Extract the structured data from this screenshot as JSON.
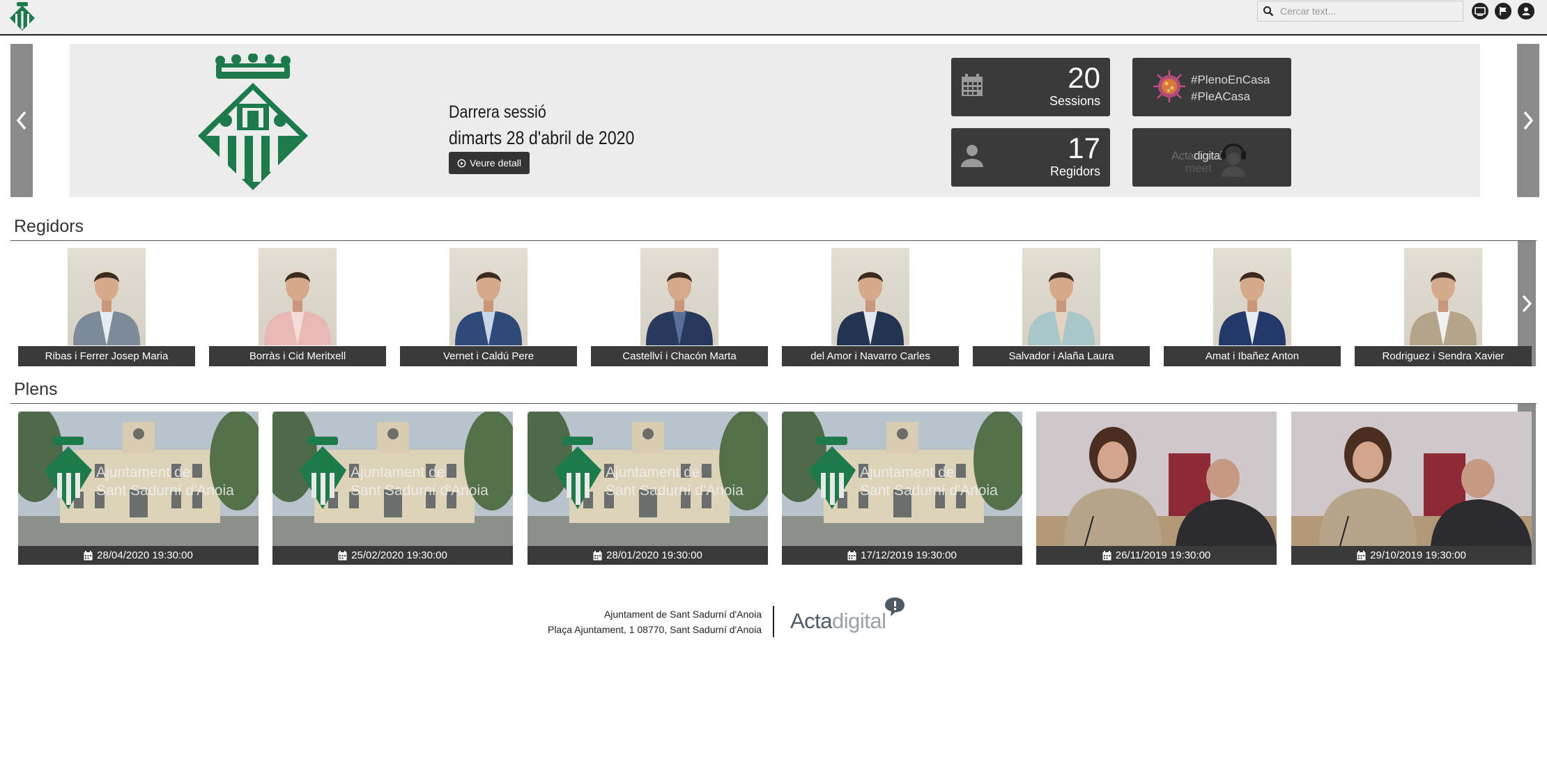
{
  "search": {
    "placeholder": "Cercar text..."
  },
  "header_icons": [
    "tv-icon",
    "flag-icon",
    "user-icon"
  ],
  "hero": {
    "last_session_label": "Darrera sessió",
    "last_session_date": "dimarts 28 d'abril de 2020",
    "detail_button": "Veure detall",
    "sessions_count": "20",
    "sessions_label": "Sessions",
    "councillors_count": "17",
    "councillors_label": "Regidors",
    "promo_line1": "#PlenoEnCasa",
    "promo_line2": "#PleACasa",
    "meet_brand": "Actadigital",
    "meet_brand_a": "Acta",
    "meet_brand_b": "digital",
    "meet_sub": "meet"
  },
  "councillors": {
    "title": "Regidors",
    "items": [
      {
        "name": "Ribas i Ferrer Josep Maria",
        "suit": "#7d8a98",
        "shirt": "#e6ecf2"
      },
      {
        "name": "Borràs i Cid Meritxell",
        "suit": "#e9b8b4",
        "shirt": "#f4dcd8"
      },
      {
        "name": "Vernet i Caldú Pere",
        "suit": "#2d4a78",
        "shirt": "#c9d6e8"
      },
      {
        "name": "Castellví i Chacón Marta",
        "suit": "#27395c",
        "shirt": "#5a6f9a"
      },
      {
        "name": "del Amor i Navarro Carles",
        "suit": "#233452",
        "shirt": "#e5e9ef"
      },
      {
        "name": "Salvador i Alaña Laura",
        "suit": "#a9c6c8",
        "shirt": "#e6d2c0"
      },
      {
        "name": "Amat i Ibañez Anton",
        "suit": "#24386a",
        "shirt": "#e7ecf3"
      },
      {
        "name": "Rodriguez i Sendra Xavier",
        "suit": "#b4a48a",
        "shirt": "#f0f0f0"
      }
    ]
  },
  "sessions": {
    "title": "Plens",
    "watermark_line1": "Ajuntament de",
    "watermark_line2": "Sant Sadurní d'Anoia",
    "items": [
      {
        "date": "28/04/2020 19:30:00",
        "kind": "building"
      },
      {
        "date": "25/02/2020 19:30:00",
        "kind": "building"
      },
      {
        "date": "28/01/2020 19:30:00",
        "kind": "building"
      },
      {
        "date": "17/12/2019 19:30:00",
        "kind": "building"
      },
      {
        "date": "26/11/2019 19:30:00",
        "kind": "meeting"
      },
      {
        "date": "29/10/2019 19:30:00",
        "kind": "meeting"
      }
    ]
  },
  "footer": {
    "line1": "Ajuntament de Sant Sadurní d'Anoia",
    "line2": "Plaça Ajuntament, 1 08770, Sant Sadurní d'Anoia",
    "brand_a": "Acta",
    "brand_b": "digital"
  },
  "colors": {
    "brand_green": "#1d7a4a",
    "tile_dark": "#3a3a3a",
    "arrow_gray": "#8a8a8a"
  }
}
